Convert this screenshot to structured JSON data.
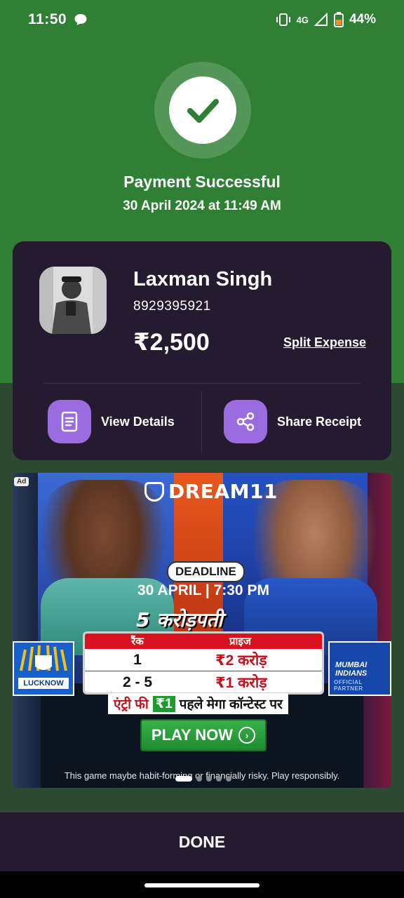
{
  "status_bar": {
    "time": "11:50",
    "network": "4G",
    "battery": "44%"
  },
  "payment": {
    "title": "Payment Successful",
    "datetime": "30 April 2024 at 11:49 AM"
  },
  "recipient": {
    "name": "Laxman Singh",
    "phone": "8929395921",
    "amount": "₹2,500",
    "split_label": "Split Expense"
  },
  "actions": {
    "view_details": "View Details",
    "share_receipt": "Share Receipt"
  },
  "ad": {
    "badge": "Ad",
    "brand": "DREAM11",
    "deadline_label": "DEADLINE",
    "deadline_date": "30 APRIL | 7:30 PM",
    "headline": "5 करोड़पती",
    "team_left": "LUCKNOW",
    "team_right": "MUMBAI INDIANS",
    "team_right_sub": "OFFICIAL PARTNER",
    "table_header": [
      "रैंक",
      "प्राइज"
    ],
    "rows": [
      {
        "rank": "1",
        "prize": "₹2 करोड़"
      },
      {
        "rank": "2 - 5",
        "prize": "₹1 करोड़"
      }
    ],
    "entry_text": "एंट्री फी",
    "entry_fee": "₹1",
    "entry_rest": "पहले मेगा कॉन्टेस्ट पर",
    "cta": "PLAY NOW",
    "disclaimer": "This game maybe habit-forming or financially risky. Play responsibly.",
    "carousel_pages": 5,
    "carousel_active": 1
  },
  "done_label": "DONE",
  "colors": {
    "success_green": "#2f7f34",
    "card_bg": "#241b30",
    "accent_purple": "#9b6be0"
  }
}
